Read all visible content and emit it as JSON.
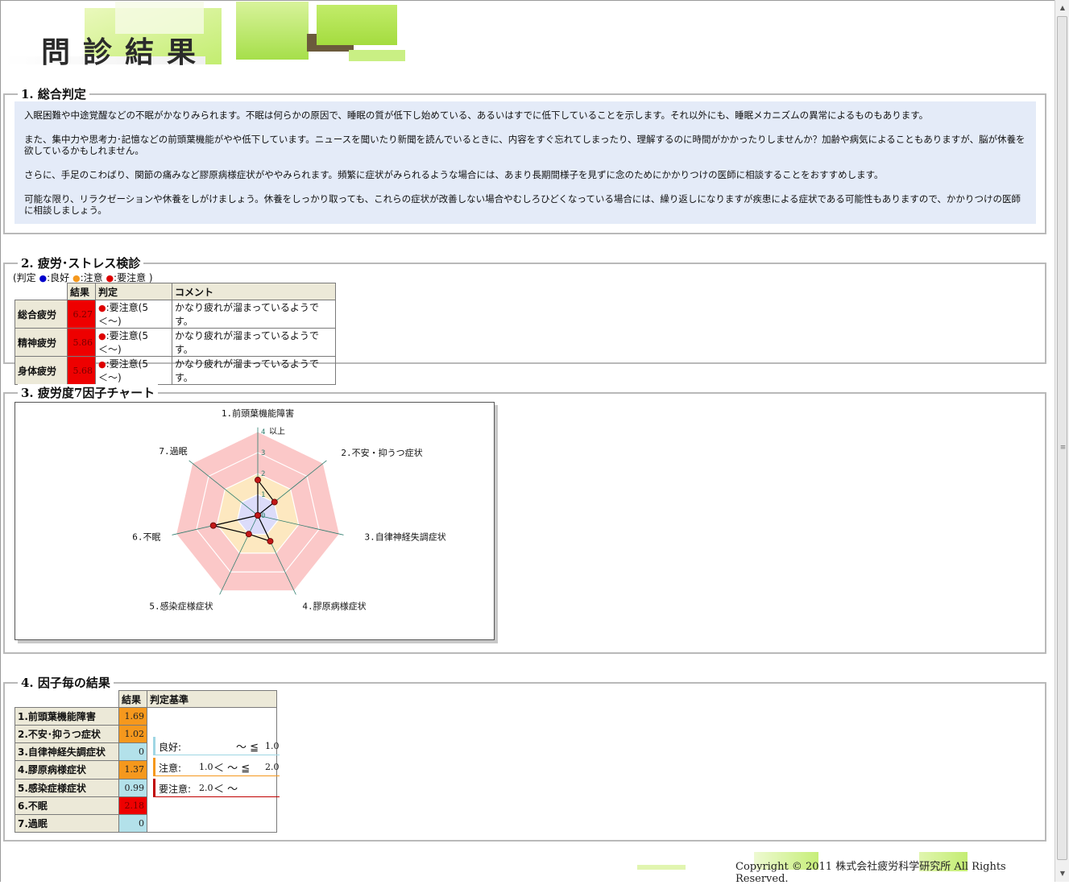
{
  "header": {
    "title": "問診結果"
  },
  "section1": {
    "legend": "1. 総合判定",
    "paragraphs": [
      "入眠困難や中途覚醒などの不眠がかなりみられます。不眠は何らかの原因で、睡眠の質が低下し始めている、あるいはすでに低下していることを示します。それ以外にも、睡眠メカニズムの異常によるものもあります。",
      "また、集中力や思考力･記憶などの前頭葉機能がやや低下しています。ニュースを聞いたり新聞を読んでいるときに、内容をすぐ忘れてしまったり、理解するのに時間がかかったりしませんか？加齢や病気によることもありますが、脳が休養を欲しているかもしれません。",
      "さらに、手足のこわばり、関節の痛みなど膠原病様症状がややみられます。頻繁に症状がみられるような場合には、あまり長期間様子を見ずに念のためにかかりつけの医師に相談することをおすすめします。",
      "可能な限り、リラクゼーションや休養をしがけましょう。休養をしっかり取っても、これらの症状が改善しない場合やむしろひどくなっている場合には、繰り返しになりますが疾患による症状である可能性もありますので、かかりつけの医師に相談しましょう。"
    ]
  },
  "section2": {
    "legend": "2. 疲労･ストレス検診",
    "note_prefix": "(判定 ",
    "note_good": ":良好 ",
    "note_caution": ":注意 ",
    "note_warning": ":要注意 )",
    "headers": [
      "結果",
      "判定",
      "コメント"
    ],
    "rows": [
      {
        "name": "総合疲労",
        "value": "6.27",
        "judge": ":要注意(5＜〜)",
        "comment": "かなり疲れが溜まっているようです。"
      },
      {
        "name": "精神疲労",
        "value": "5.86",
        "judge": ":要注意(5＜〜)",
        "comment": "かなり疲れが溜まっているようです。"
      },
      {
        "name": "身体疲労",
        "value": "5.68",
        "judge": ":要注意(5＜〜)",
        "comment": "かなり疲れが溜まっているようです。"
      }
    ],
    "colors": {
      "good": "#0000cc",
      "caution": "#f5981d",
      "warning": "#dd0000"
    }
  },
  "section3": {
    "legend": "3. 疲労度7因子チャート"
  },
  "chart_data": {
    "type": "radar",
    "categories": [
      "1.前頭葉機能障害",
      "2.不安・抑うつ症状",
      "3.自律神経失調症状",
      "4.膠原病様症状",
      "5.感染症様症状",
      "6.不眠",
      "7.過眠"
    ],
    "values": [
      1.69,
      1.02,
      0,
      1.37,
      0.99,
      2.18,
      0
    ],
    "scale_labels": [
      "0",
      "1",
      "2",
      "3",
      "4"
    ],
    "max_label": "以上",
    "ylim": [
      0,
      4
    ],
    "zones": [
      {
        "name": "良好",
        "max": 1,
        "color": "#dcdcfa"
      },
      {
        "name": "注意",
        "max": 2,
        "color": "#fde8c0"
      },
      {
        "name": "要注意",
        "max": 4,
        "color": "#fbc8c8"
      }
    ]
  },
  "section4": {
    "legend": "4. 因子毎の結果",
    "headers": [
      "結果",
      "判定基準"
    ],
    "rows": [
      {
        "name": "1.前頭葉機能障害",
        "value": "1.69",
        "level": "orange"
      },
      {
        "name": "2.不安･抑うつ症状",
        "value": "1.02",
        "level": "orange"
      },
      {
        "name": "3.自律神経失調症状",
        "value": "0",
        "level": "blue"
      },
      {
        "name": "4.膠原病様症状",
        "value": "1.37",
        "level": "orange"
      },
      {
        "name": "5.感染症様症状",
        "value": "0.99",
        "level": "blue"
      },
      {
        "name": "6.不眠",
        "value": "2.18",
        "level": "red"
      },
      {
        "name": "7.過眠",
        "value": "0",
        "level": "blue"
      }
    ],
    "criteria": [
      {
        "label": "良好:",
        "range": "〜 ≦",
        "upper": "1.0",
        "color": "#9fd6e4"
      },
      {
        "label": "注意:",
        "lower": "1.0",
        "range": "＜ 〜 ≦",
        "upper": "2.0",
        "color": "#f5981d"
      },
      {
        "label": "要注意:",
        "lower": "2.0",
        "range": "＜ 〜",
        "color": "#c00000"
      }
    ]
  },
  "footer": {
    "copyright": "Copyright © 2011 株式会社疲労科学研究所 All Rights Reserved."
  }
}
